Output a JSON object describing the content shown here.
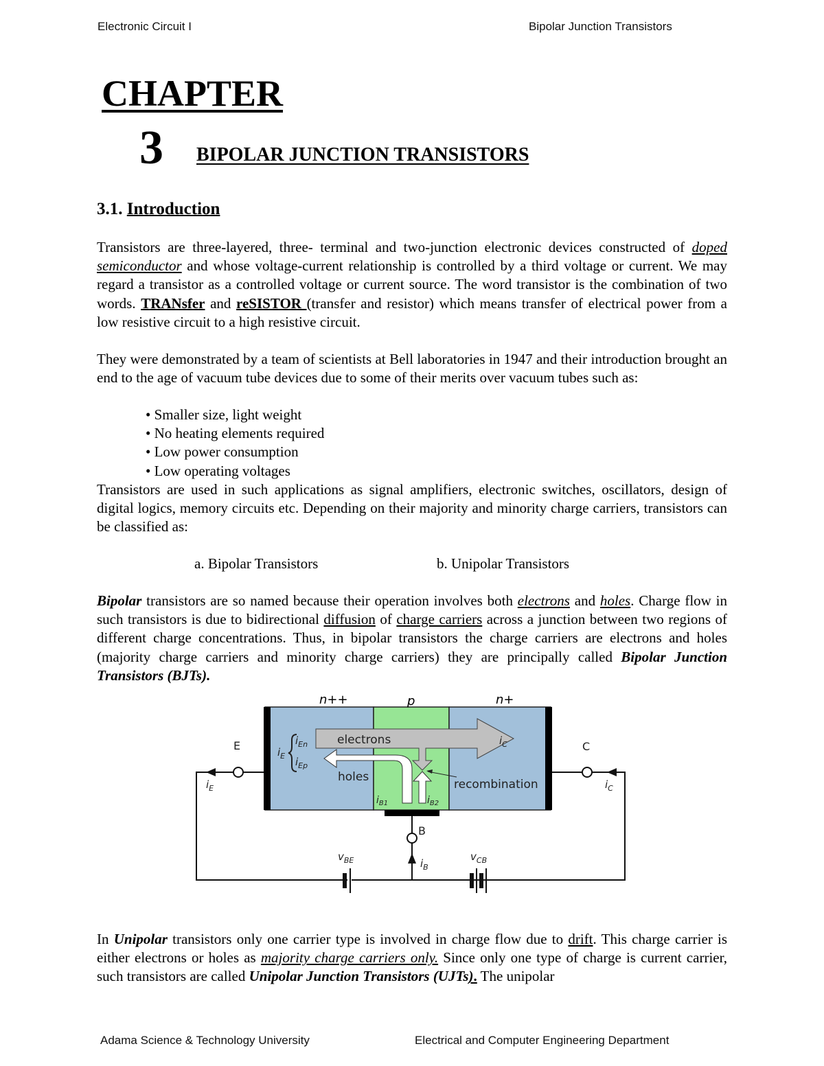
{
  "header": {
    "left": "Electronic Circuit I",
    "right": "Bipolar Junction Transistors"
  },
  "chapter": {
    "label": "CHAPTER",
    "number": "3",
    "title": "BIPOLAR JUNCTION TRANSISTORS"
  },
  "section": {
    "number": "3.1.",
    "title": "Introduction"
  },
  "paragraph1": {
    "s1": " Transistors are three-layered, three- terminal and two-junction electronic devices constructed of ",
    "doped": "doped",
    "semiconductor": "semiconductor",
    "s2": " and whose voltage-current relationship is controlled by a third voltage or current. We may regard a transistor as a controlled voltage or current source. The word transistor is the combination of two words. ",
    "transfer": "TRANsfer",
    "and": " and ",
    "resistor": "reSISTOR ",
    "s3": "(transfer and resistor) which means transfer of electrical power from a low resistive circuit to a high resistive circuit."
  },
  "paragraph2": {
    "text": "They were demonstrated by a team of scientists at Bell laboratories in 1947 and their introduction brought an end to the age of vacuum tube devices due to some of their merits over vacuum tubes such as:"
  },
  "merits": [
    "• Smaller size, light weight",
    "• No heating elements required",
    "• Low power consumption",
    "• Low operating voltages"
  ],
  "paragraph3": {
    "text": "Transistors are used in such applications as signal amplifiers, electronic switches, oscillators, design of digital logics, memory circuits etc. Depending on their majority and minority charge carriers, transistors can be classified as:"
  },
  "classification": {
    "a": "a.   Bipolar Transistors",
    "b": "b. Unipolar Transistors"
  },
  "paragraph4": {
    "bipolar": "Bipolar",
    "s1": " transistors are so named because their operation involves both ",
    "electrons": "electrons",
    "s2": " and ",
    "holes": "holes",
    "s3": ". Charge flow in such transistors is due to bidirectional ",
    "diffusion": "diffusion",
    "s4": " of ",
    "charge_carriers": "charge carriers",
    "s5": " across a junction between two regions of different charge concentrations. Thus, in bipolar transistors the charge carriers are electrons and holes (majority charge carriers and minority charge carriers) they are principally called ",
    "bjts": "Bipolar Junction Transistors (BJTs)."
  },
  "diagram": {
    "region_emitter": "n++",
    "region_base": "p",
    "region_collector": "n+",
    "electrons_label": "electrons",
    "holes_label": "holes",
    "recombination_label": "recombination",
    "terminal_e": "E",
    "terminal_b": "B",
    "terminal_c": "C",
    "i_e": "i",
    "i_e_sub": "E",
    "i_en_sub": "En",
    "i_ep_sub": "Ep",
    "i_c_sub": "C",
    "i_b_sub": "B",
    "i_b1_sub": "B1",
    "i_b2_sub": "B2",
    "v": "v",
    "v_be_sub": "BE",
    "v_cb_sub": "CB",
    "colors": {
      "n_region": "#a2c0da",
      "p_region": "#97e595",
      "electron_arrow": "#c0c0c0",
      "hole_arrow": "#ffffff"
    }
  },
  "paragraph5": {
    "in": "In ",
    "unipolar": "Unipolar",
    "s1": " transistors only one carrier type is involved in charge flow due to ",
    "drift": "drift",
    "s2": ". This charge carrier is either electrons or holes as ",
    "majority": "majority charge carriers only.",
    "s3": " Since only one type of charge is current carrier, such transistors are called ",
    "ujts": "Unipolar Junction Transistors (UJTs",
    "close": ")",
    "dot": ".",
    "s4": " The unipolar"
  },
  "footer": {
    "left": "Adama Science & Technology University",
    "right": "Electrical and Computer Engineering Department"
  }
}
